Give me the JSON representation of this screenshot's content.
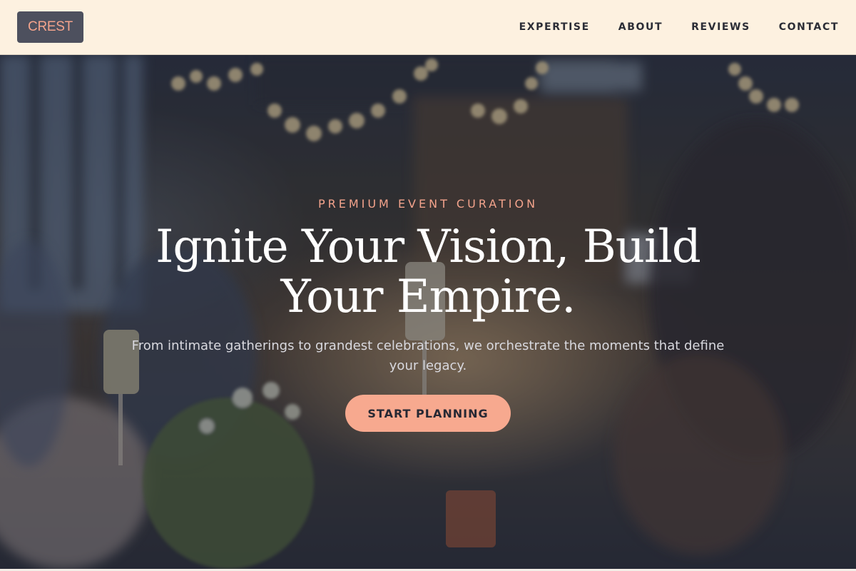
{
  "nav": {
    "logo": "CREST",
    "links": [
      "EXPERTISE",
      "ABOUT",
      "REVIEWS",
      "CONTACT"
    ]
  },
  "hero": {
    "eyebrow": "PREMIUM EVENT CURATION",
    "headline": "Ignite Your Vision, Build Your Empire.",
    "subtext": "From intimate gatherings to grandest celebrations, we orchestrate the moments that define your legacy.",
    "cta_label": "START PLANNING"
  },
  "colors": {
    "nav_background": "#fdf1e0",
    "logo_background": "#4d505e",
    "accent": "#f3a38c",
    "cta_background": "#f7a98f"
  }
}
